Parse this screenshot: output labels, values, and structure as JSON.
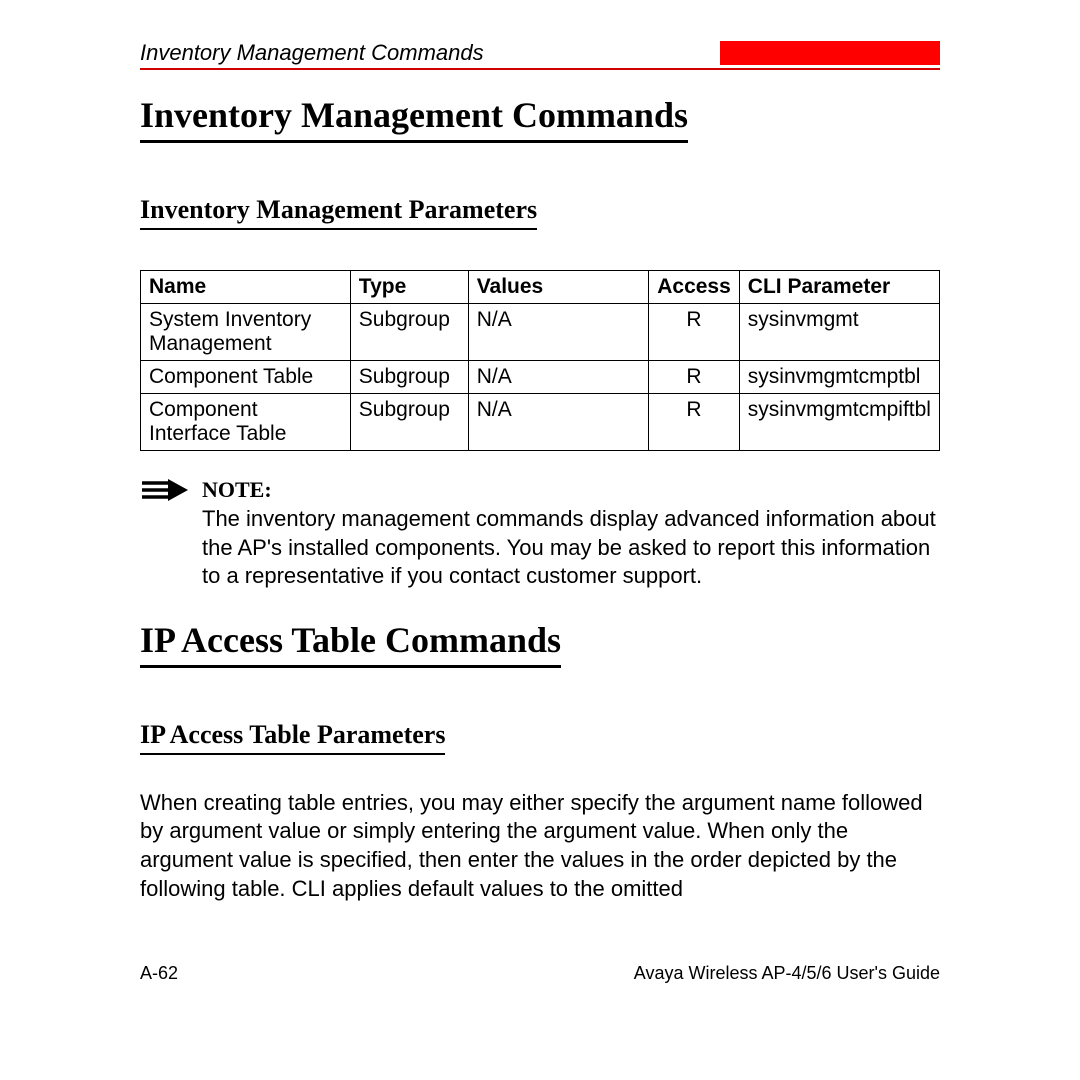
{
  "header": {
    "running_title": "Inventory Management Commands"
  },
  "sections": {
    "s1": {
      "title": "Inventory Management Commands",
      "subtitle": "Inventory Management Parameters"
    },
    "s2": {
      "title": "IP Access Table Commands",
      "subtitle": "IP Access Table Parameters",
      "paragraph": "When creating table entries, you may either specify the argument name followed by argument value or simply entering the argument value. When only the argument value is specified, then enter the values in the order depicted by the following table. CLI applies default values to the omitted"
    }
  },
  "table": {
    "headers": {
      "name": "Name",
      "type": "Type",
      "values": "Values",
      "access": "Access",
      "cli": "CLI Parameter"
    },
    "rows": [
      {
        "name": "System Inventory Management",
        "type": "Subgroup",
        "values": "N/A",
        "access": "R",
        "cli": "sysinvmgmt"
      },
      {
        "name": "Component Table",
        "type": "Subgroup",
        "values": "N/A",
        "access": "R",
        "cli": "sysinvmgmtcmptbl"
      },
      {
        "name": "Component Interface Table",
        "type": "Subgroup",
        "values": "N/A",
        "access": "R",
        "cli": "sysinvmgmtcmpiftbl"
      }
    ]
  },
  "note": {
    "label": "NOTE:",
    "text": "The inventory management commands display advanced information about the AP's installed components. You may be asked to report this information to a representative if you contact customer support."
  },
  "footer": {
    "page_number": "A-62",
    "guide": "Avaya Wireless AP-4/5/6 User's Guide"
  }
}
